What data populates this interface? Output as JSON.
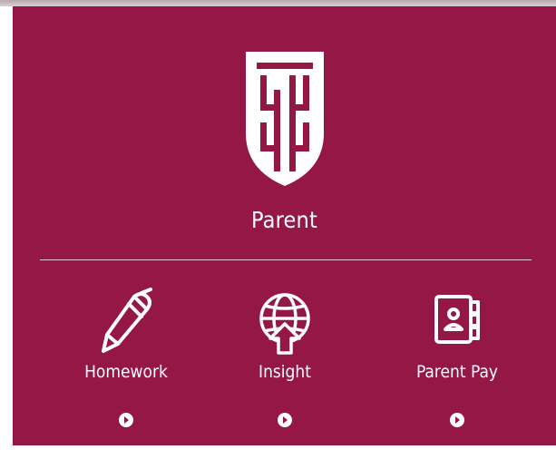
{
  "colors": {
    "panel_background": "#951745",
    "foreground": "#ffffff"
  },
  "header": {
    "logo_icon": "school-crest-icon",
    "role_title": "Parent"
  },
  "tiles": [
    {
      "label": "Homework",
      "icon": "pencil-icon",
      "action_icon": "play-circle-icon"
    },
    {
      "label": "Insight",
      "icon": "globe-upload-icon",
      "action_icon": "play-circle-icon"
    },
    {
      "label": "Parent Pay",
      "icon": "contact-book-icon",
      "action_icon": "play-circle-icon"
    }
  ]
}
